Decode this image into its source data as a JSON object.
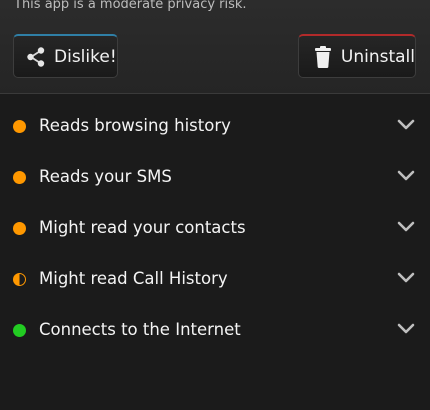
{
  "header": {
    "risk_text": "This app is a moderate privacy risk.",
    "dislike_label": "Dislike!",
    "uninstall_label": "Uninstall"
  },
  "colors": {
    "moderate": "#ff9800",
    "safe": "#22cc22",
    "dislike_accent": "#2f7fa6",
    "uninstall_accent": "#b22a2a"
  },
  "permissions": [
    {
      "label": "Reads browsing history",
      "status": "moderate",
      "icon": "orange-dot-icon"
    },
    {
      "label": "Reads your SMS",
      "status": "moderate",
      "icon": "orange-dot-icon"
    },
    {
      "label": "Might read your contacts",
      "status": "moderate",
      "icon": "orange-dot-icon"
    },
    {
      "label": "Might read Call History",
      "status": "partial",
      "icon": "half-orange-dot-icon"
    },
    {
      "label": "Connects to the Internet",
      "status": "safe",
      "icon": "green-dot-icon"
    }
  ]
}
